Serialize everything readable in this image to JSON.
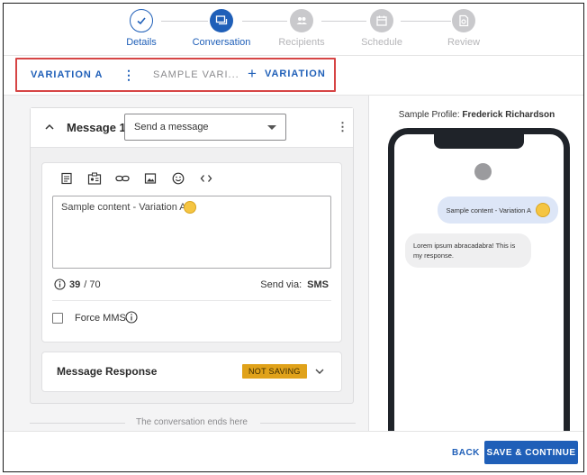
{
  "stepper": {
    "steps": [
      {
        "label": "Details",
        "state": "done",
        "icon": "check-icon"
      },
      {
        "label": "Conversation",
        "state": "active",
        "icon": "chat-icon"
      },
      {
        "label": "Recipients",
        "state": "todo",
        "icon": "people-icon"
      },
      {
        "label": "Schedule",
        "state": "todo",
        "icon": "calendar-icon"
      },
      {
        "label": "Review",
        "state": "todo",
        "icon": "review-icon"
      }
    ]
  },
  "variations": {
    "active_tab": "VARIATION A",
    "second_tab": "SAMPLE VARI...",
    "add_label": "VARIATION"
  },
  "message": {
    "title": "Message 1",
    "type_select": "Send a message",
    "content": "Sample content - Variation A",
    "char_count": "39",
    "char_limit": "/ 70",
    "send_via_label": "Send via:",
    "send_via_value": "SMS",
    "force_mms_label": "Force MMS"
  },
  "response": {
    "title": "Message Response",
    "badge": "NOT SAVING"
  },
  "conversation_end": "The conversation ends here",
  "preview": {
    "profile_label": "Sample Profile:",
    "profile_name": "Frederick Richardson",
    "outgoing": "Sample content - Variation A",
    "incoming": "Lorem ipsum abracadabra! This is my response."
  },
  "footer": {
    "back_label": "BACK",
    "save_label": "SAVE & CONTINUE"
  },
  "colors": {
    "accent": "#1f5fb8",
    "highlight_border": "#d64545",
    "badge": "#e0a21a"
  }
}
